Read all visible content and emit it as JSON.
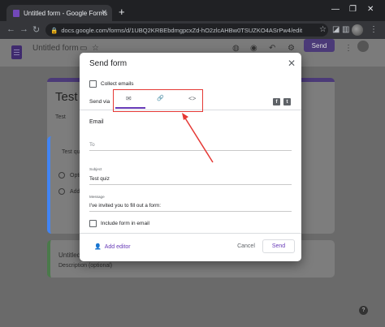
{
  "browser": {
    "tab_title": "Untitled form - Google Forms",
    "tab_close": "✕",
    "new_tab": "+",
    "url": "docs.google.com/forms/d/1UBQ2KRBEbdmgpcxZd-hO2zlcAHBw0TSUZKO4ASrPw4/edit",
    "controls": {
      "minimize": "—",
      "maximize": "❐",
      "close": "✕"
    }
  },
  "forms_header": {
    "doc_title": "Untitled form",
    "send_label": "Send"
  },
  "background": {
    "card1_title": "Test",
    "card1_desc": "Test",
    "question_title": "Test qu",
    "option1": "Option",
    "option_add": "Add o",
    "card2_title": "Untitled T",
    "card2_desc": "Description (optional)"
  },
  "dialog": {
    "title": "Send form",
    "close": "✕",
    "collect_emails": "Collect emails",
    "send_via": "Send via",
    "icons": {
      "email": "✉",
      "link": "🔗",
      "embed": "<>"
    },
    "social": {
      "facebook": "f",
      "twitter": "t"
    },
    "email_section": "Email",
    "to_placeholder": "To",
    "subject_caption": "Subject",
    "subject_value": "Test quiz",
    "message_caption": "Message",
    "message_value": "I've invited you to fill out a form:",
    "include_form": "Include form in email",
    "add_editor": "Add editor",
    "cancel": "Cancel",
    "send": "Send"
  },
  "colors": {
    "accent": "#673ab7",
    "annotation": "#e53935"
  }
}
